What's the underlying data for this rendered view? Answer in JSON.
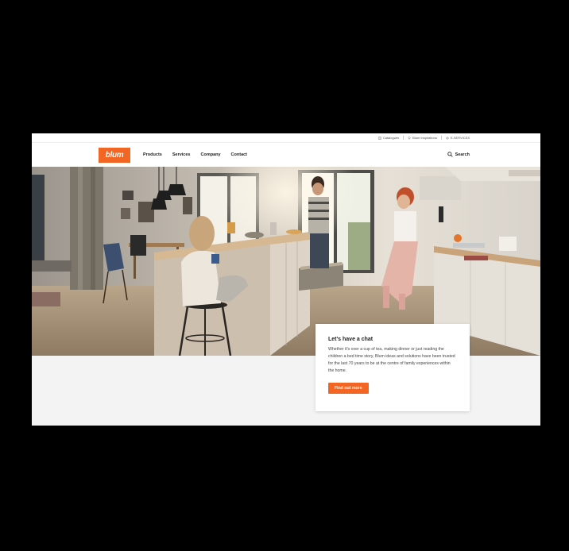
{
  "utility_nav": {
    "items": [
      {
        "label": "Catalogues",
        "icon": "book-icon"
      },
      {
        "label": "Blum Inspirations",
        "icon": "lightbulb-icon"
      },
      {
        "label": "E-SERVICES",
        "icon": "gear-icon"
      }
    ]
  },
  "header": {
    "logo_text": "blum",
    "nav": [
      "Products",
      "Services",
      "Company",
      "Contact"
    ],
    "search_label": "Search"
  },
  "hero": {
    "image_description_icon": "kitchen-scene-photo"
  },
  "card": {
    "title": "Let's have a chat",
    "body": "Whether it's over a cup of tea, making dinner or just reading the children a bed time story, Blum ideas and solutions have been trusted for the last 70 years to be at the centre of family experiences within the home.",
    "cta_label": "Find out more"
  },
  "colors": {
    "brand": "#f26522",
    "background": "#000000",
    "panel": "#f3f3f3"
  }
}
